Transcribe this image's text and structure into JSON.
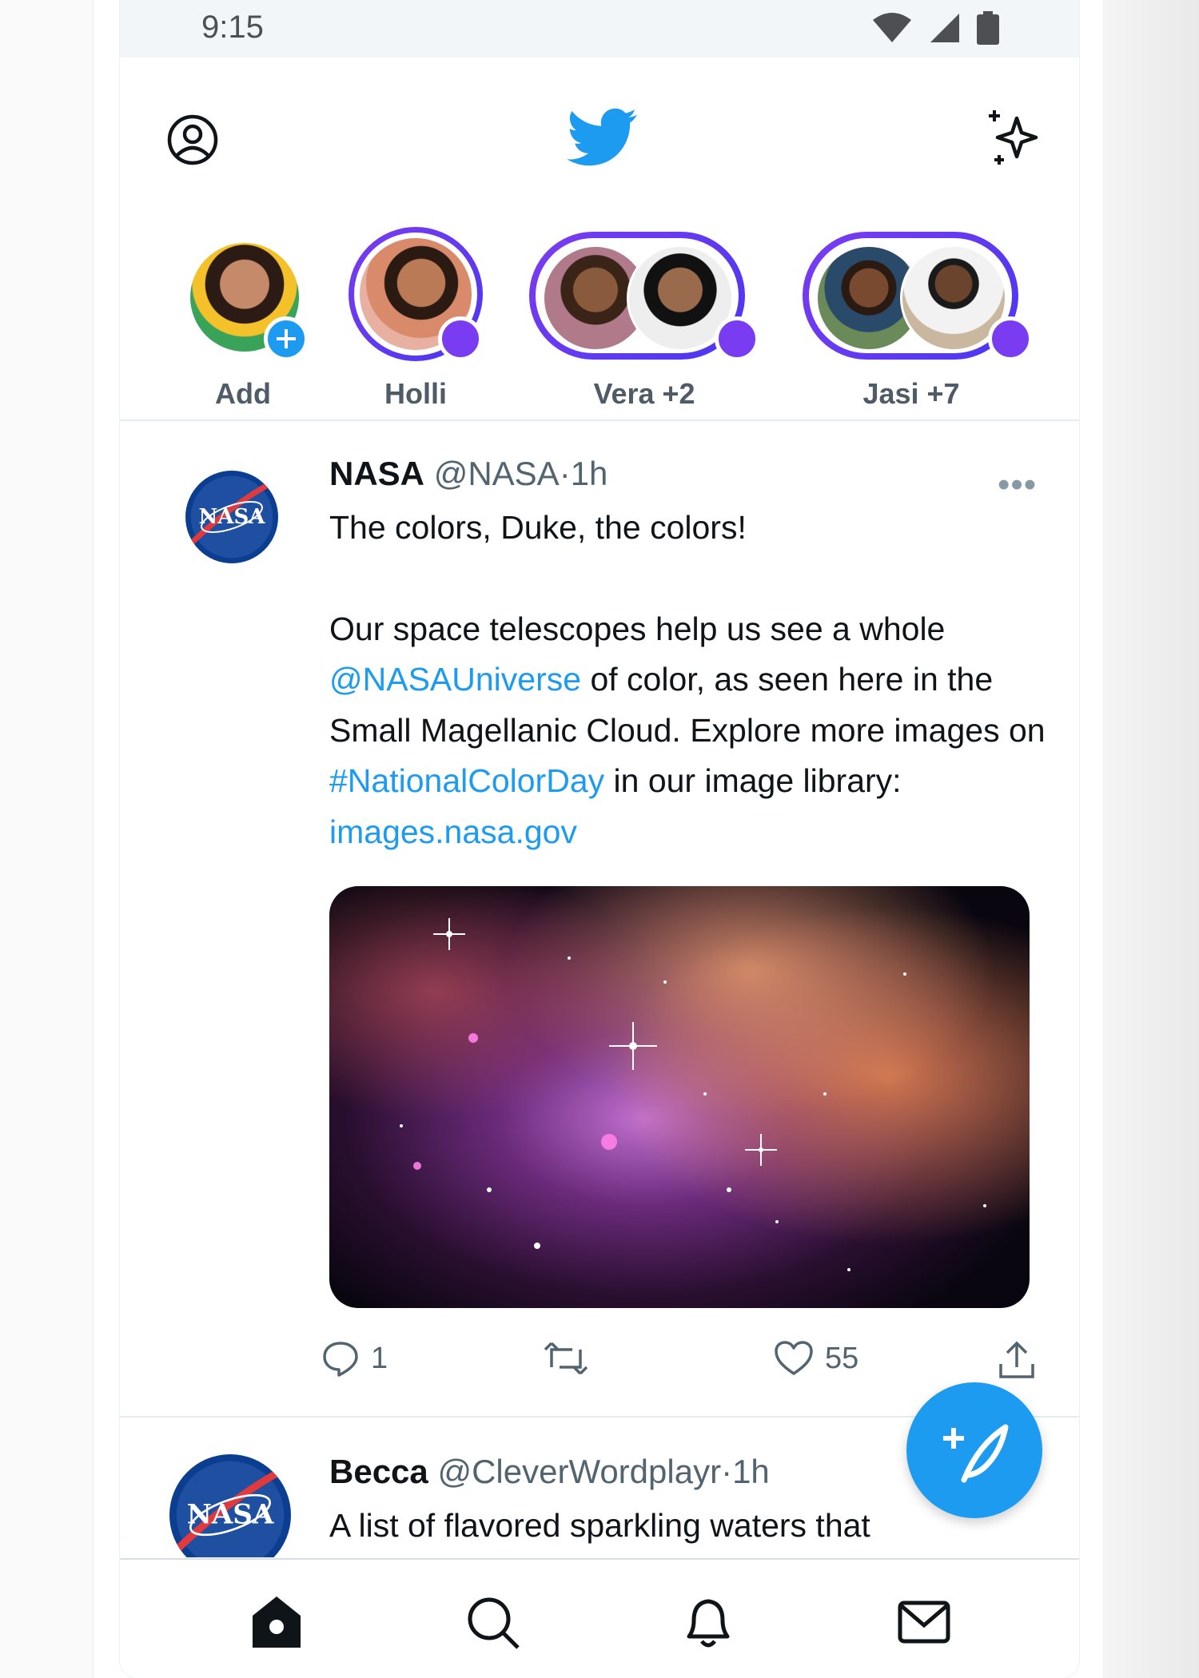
{
  "status_bar": {
    "time": "9:15"
  },
  "fleets": [
    {
      "label": "Add"
    },
    {
      "label": "Holli"
    },
    {
      "label": "Vera +2"
    },
    {
      "label": "Jasi +7"
    }
  ],
  "tweets": [
    {
      "name": "NASA",
      "handle": "@NASA",
      "time": "1h",
      "text": {
        "line1": "The colors, Duke, the colors!",
        "p2_a": "Our space telescopes help us see a whole ",
        "mention": "@NASAUniverse",
        "p2_b": " of color, as seen here in the Small Magellanic Cloud. Explore more images on ",
        "hashtag": "#NationalColorDay",
        "p2_c": " in our image library: ",
        "url": "images.nasa.gov"
      },
      "replies": "1",
      "likes": "55"
    },
    {
      "name": "Becca",
      "handle": "@CleverWordplayr",
      "time": "1h",
      "text": "A list of flavored sparkling waters that"
    }
  ],
  "colors": {
    "accent": "#1d9bf0",
    "fleet_ring": "#6a3af0"
  },
  "icons": {
    "topbar": [
      "profile-icon",
      "twitter-bird-icon",
      "sparkle-icon"
    ],
    "nav": [
      "home-icon",
      "search-icon",
      "notifications-icon",
      "messages-icon"
    ],
    "actions": [
      "reply-icon",
      "retweet-icon",
      "like-icon",
      "share-icon"
    ]
  }
}
